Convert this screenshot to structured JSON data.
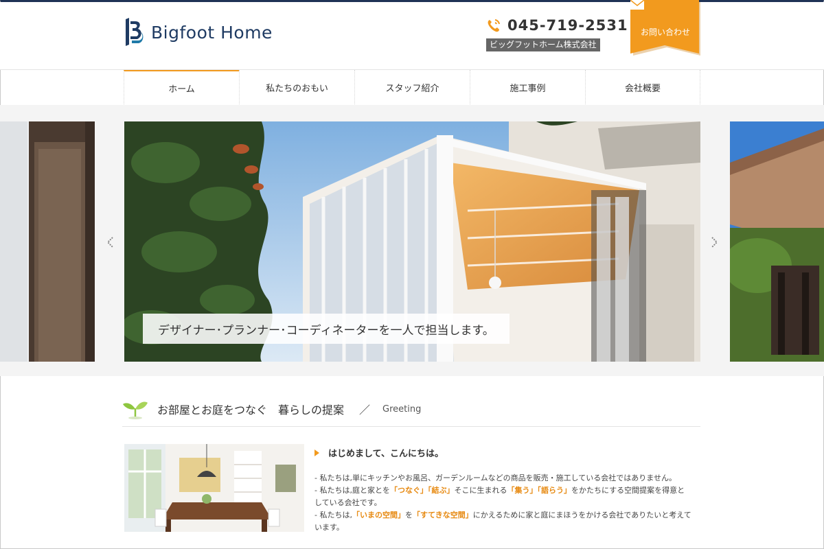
{
  "header": {
    "logo_text": "Bigfoot Home",
    "phone_number": "045-719-2531",
    "company_name": "ビッグフットホーム株式会社",
    "contact_label": "お問い合わせ",
    "accent_color": "#f29a1e",
    "brand_color": "#1f3b63"
  },
  "nav": {
    "items": [
      {
        "label": "ホーム",
        "active": true
      },
      {
        "label": "私たちのおもい",
        "active": false
      },
      {
        "label": "スタッフ紹介",
        "active": false
      },
      {
        "label": "施工事例",
        "active": false
      },
      {
        "label": "会社概要",
        "active": false
      }
    ]
  },
  "slider": {
    "caption": "デザイナー･プランナー･コーディネーターを一人で担当します。"
  },
  "greeting": {
    "title": "お部屋とお庭をつなぐ　暮らしの提案",
    "slash": "／",
    "title_en": "Greeting",
    "heading": "はじめまして、こんにちは。",
    "line1": "- 私たちは,単にキッチンやお風呂、ガーデンルームなどの商品を販売・施工している会社ではありません。",
    "line2_a": "- 私たちは,庭と家とを",
    "line2_hl1": "「つなぐ」「結ぶ」",
    "line2_b": "そこに生まれる",
    "line2_hl2": "「集う」「語らう」",
    "line2_c": "をかたちにする空間提案を得意と",
    "line3": "している会社です。",
    "line4_a": "- 私たちは,",
    "line4_hl1": "「いまの空間」",
    "line4_b": "を",
    "line4_hl2": "「すてきな空間」",
    "line4_c": "にかえるために家と庭にまほうをかける会社でありたいと考えて",
    "line5": "います。"
  }
}
